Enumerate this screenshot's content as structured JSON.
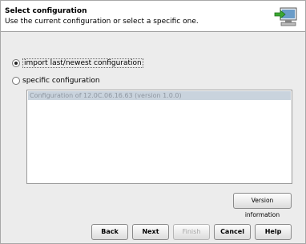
{
  "header": {
    "title": "Select configuration",
    "description": "Use the current configuration or select a specific one."
  },
  "options": {
    "import_latest_label": "import last/newest configuration",
    "specific_label": "specific configuration",
    "selected": "import_latest"
  },
  "config_list": {
    "items": [
      "Configuration of 12.0C.06.16.63 (version 1.0.0)"
    ]
  },
  "buttons": {
    "version_info": "Version information",
    "back": "Back",
    "next": "Next",
    "finish": "Finish",
    "cancel": "Cancel",
    "help": "Help"
  },
  "icons": {
    "wizard": "monitor-with-green-arrow-icon"
  }
}
